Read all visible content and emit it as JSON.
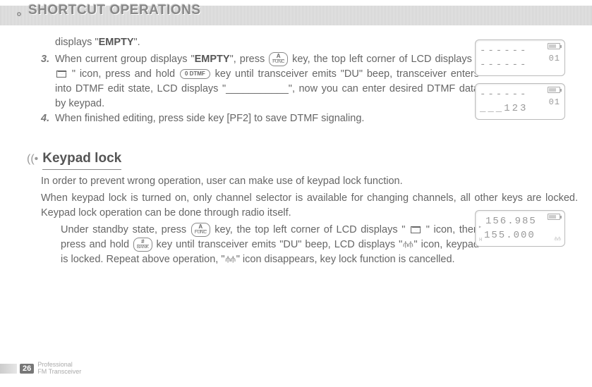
{
  "header": {
    "title": "SHORTCUT OPERATIONS"
  },
  "body": {
    "line_displays": "displays \"",
    "empty1": "EMPTY",
    "line_displays_end": "\".",
    "item3_num": "3.",
    "item3_a": "When current group displays \"",
    "item3_empty": "EMPTY",
    "item3_b": "\", press ",
    "item3_c": " key, the top left corner of LCD displays \" ",
    "item3_d": " \" icon, press and hold ",
    "item3_e": " key until transceiver emits \"DU\" beep, transceiver enters into DTMF edit state, LCD displays \"___________\", now you can enter desired DTMF data by keypad.",
    "item4_num": "4.",
    "item4_a": "When finished editing, press side key [PF2] to save DTMF signaling.",
    "section2_title": "Keypad lock",
    "kp_p1": "In order to prevent wrong operation, user can make use of keypad lock function.",
    "kp_p2": "When keypad lock is turned on, only channel selector is available for changing channels, all other keys are locked. Keypad lock operation can be done through radio itself.",
    "kp_p3_a": "Under standby state, press ",
    "kp_p3_b": " key, the top left corner of LCD displays \" ",
    "kp_p3_c": " \" icon, then press and hold ",
    "kp_p3_d": " key until transceiver emits \"DU\" beep, LCD displays \"",
    "kp_p3_e": "\" icon, keypad is locked. Repeat above operation, \"",
    "kp_p3_f": "\" icon disappears, key lock function is cancelled."
  },
  "keys": {
    "func_top": "A",
    "func_bot": "FUNC",
    "dtmf": "0 DTMF",
    "bank_top": "#",
    "bank_bot": "BANK"
  },
  "lcd1": {
    "line1": "------",
    "line2": "------",
    "side": "01"
  },
  "lcd2": {
    "line1": "------",
    "line2": "___123",
    "side": "01"
  },
  "lcd3": {
    "line1": "156.985",
    "line2": "155.000"
  },
  "footer": {
    "page": "26",
    "text1": "Professional",
    "text2": "FM Transceiver"
  }
}
